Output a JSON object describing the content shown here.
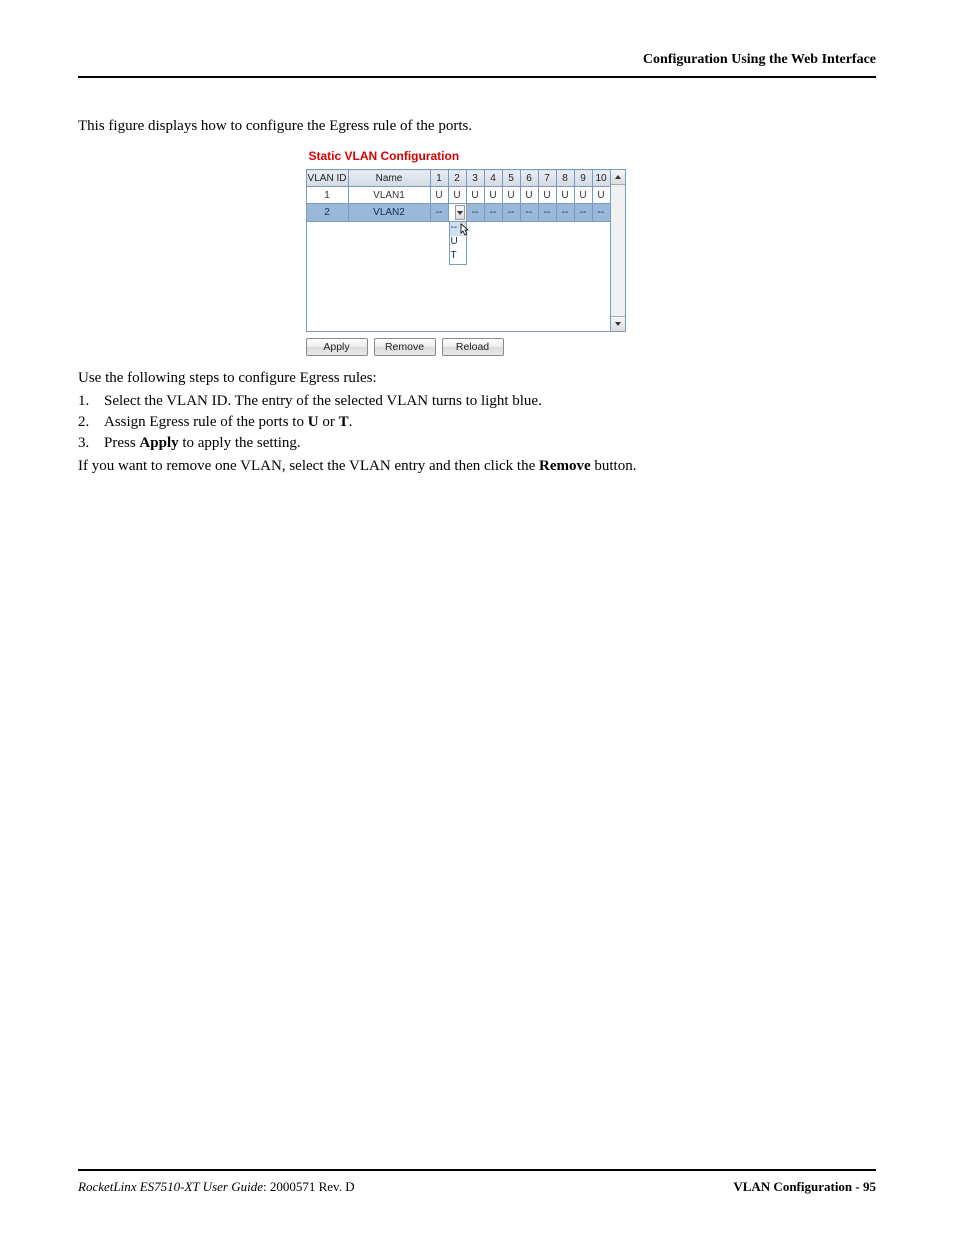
{
  "header": {
    "title": "Configuration Using the Web Interface"
  },
  "intro": "This figure displays how to configure the Egress rule of the ports.",
  "screenshot": {
    "title": "Static VLAN Configuration",
    "columns": {
      "id": "VLAN ID",
      "name": "Name",
      "ports": [
        "1",
        "2",
        "3",
        "4",
        "5",
        "6",
        "7",
        "8",
        "9",
        "10"
      ]
    },
    "rows": [
      {
        "id": "1",
        "name": "VLAN1",
        "ports": [
          "U",
          "U",
          "U",
          "U",
          "U",
          "U",
          "U",
          "U",
          "U",
          "U"
        ],
        "selected": false
      },
      {
        "id": "2",
        "name": "VLAN2",
        "ports": [
          "--",
          "",
          "--",
          "--",
          "--",
          "--",
          "--",
          "--",
          "--",
          "--"
        ],
        "selected": true
      }
    ],
    "dropdown": {
      "options": [
        "--",
        "U",
        "T"
      ],
      "selected_index": 0
    },
    "buttons": {
      "apply": "Apply",
      "remove": "Remove",
      "reload": "Reload"
    }
  },
  "steps_intro": "Use the following steps to configure Egress rules:",
  "steps": [
    {
      "n": "1.",
      "text_a": "Select the VLAN ID. The entry of the selected VLAN turns to light blue."
    },
    {
      "n": "2.",
      "text_a": "Assign Egress rule of the ports to ",
      "b1": "U",
      "mid": " or ",
      "b2": "T",
      "tail": "."
    },
    {
      "n": "3.",
      "text_a": "Press ",
      "b1": "Apply",
      "tail": " to apply the setting."
    }
  ],
  "note": {
    "a": "If you want to remove one VLAN, select the VLAN entry and then click the ",
    "b": "Remove",
    "c": " button."
  },
  "footer": {
    "product": "RocketLinx ES7510-XT  User Guide",
    "doc": ": 2000571 Rev. D",
    "section": "VLAN Configuration - 95"
  }
}
